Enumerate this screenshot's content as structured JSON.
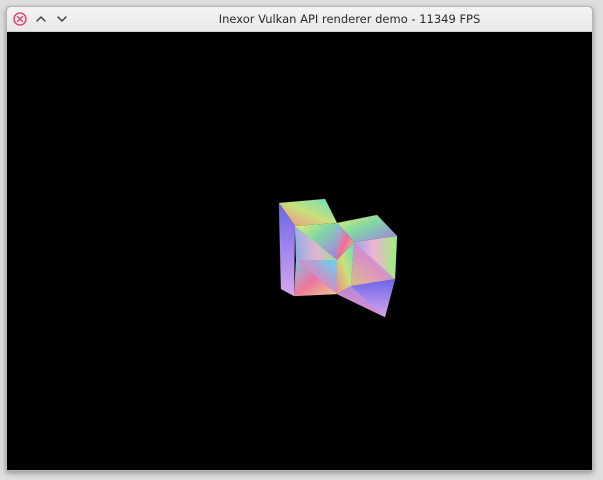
{
  "window": {
    "title": "Inexor Vulkan API renderer demo - 11349 FPS"
  },
  "icons": {
    "close": "close-icon",
    "maximize": "chevron-up-icon",
    "minimize": "chevron-down-icon"
  },
  "colors": {
    "titlebar": "#ececec",
    "close_accent": "#e0457b",
    "viewport": "#000000"
  }
}
